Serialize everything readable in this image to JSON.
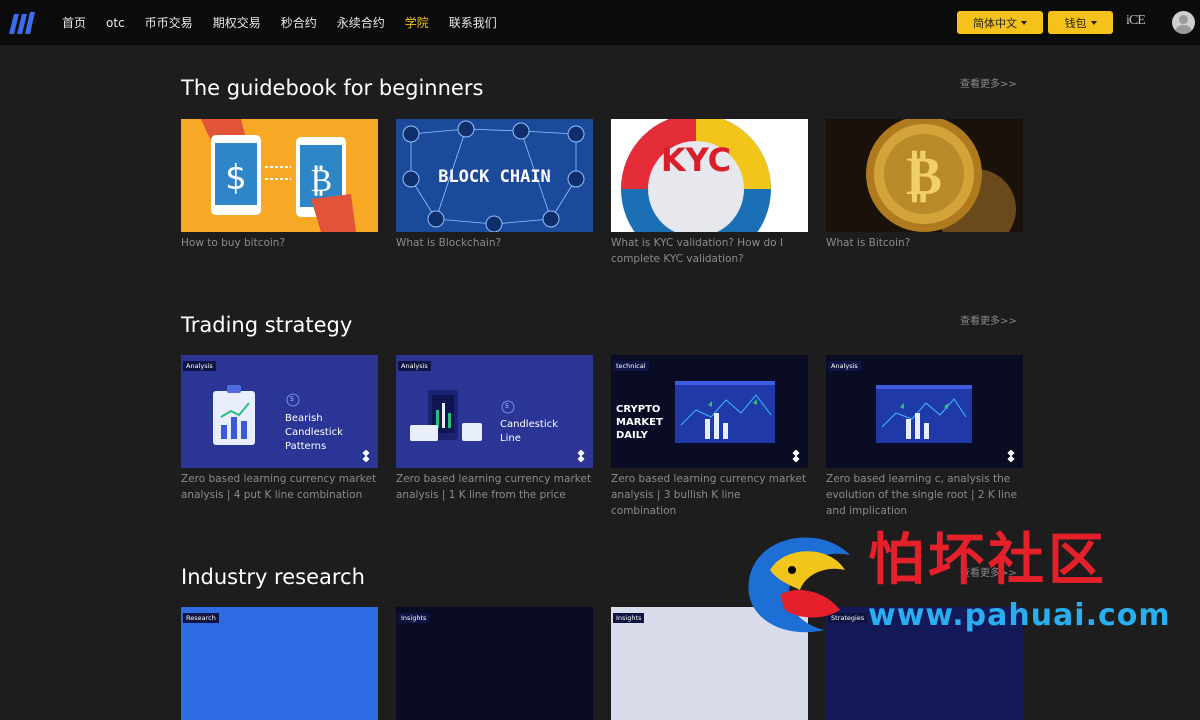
{
  "nav": {
    "items": [
      {
        "label": "首页",
        "active": false
      },
      {
        "label": "otc",
        "active": false
      },
      {
        "label": "币币交易",
        "active": false
      },
      {
        "label": "期权交易",
        "active": false
      },
      {
        "label": "秒合约",
        "active": false
      },
      {
        "label": "永续合约",
        "active": false
      },
      {
        "label": "学院",
        "active": true
      },
      {
        "label": "联系我们",
        "active": false
      }
    ],
    "language_label": "简体中文",
    "wallet_label": "钱包",
    "brand_mark": "iCE"
  },
  "sections": [
    {
      "title": "The guidebook for beginners",
      "more_label": "查看更多>>",
      "cards": [
        {
          "caption": "How to buy bitcoin?",
          "thumb": "buy-bitcoin"
        },
        {
          "caption": "What is Blockchain?",
          "thumb": "block-chain",
          "thumb_text": "BLOCK CHAIN"
        },
        {
          "caption": "What is KYC validation? How do I complete KYC validation?",
          "thumb": "kyc",
          "thumb_text": "KYC"
        },
        {
          "caption": "What is Bitcoin?",
          "thumb": "bitcoin-coin"
        }
      ]
    },
    {
      "title": "Trading strategy",
      "more_label": "查看更多>>",
      "cards": [
        {
          "caption": "Zero based learning currency market analysis | 4 put K line combination",
          "tag": "Analysis",
          "thumb_text": "Bearish Candlestick Patterns",
          "step": "5"
        },
        {
          "caption": "Zero based learning currency market analysis | 1 K line from the price",
          "tag": "Analysis",
          "thumb_text": "Candlestick Line",
          "step": "5"
        },
        {
          "caption": "Zero based learning currency market analysis | 3 bullish K line combination",
          "tag": "technical",
          "thumb_text": "CRYPTO MARKET DAILY"
        },
        {
          "caption": "Zero based learning c, analysis the evolution of the single root | 2 K line and implication",
          "tag": "Analysis"
        }
      ]
    },
    {
      "title": "Industry research",
      "more_label": "查看更多>>",
      "cards": [
        {
          "tag": "Research"
        },
        {
          "tag": "Insights"
        },
        {
          "tag": "Insights"
        },
        {
          "tag": "Strategies"
        }
      ]
    }
  ],
  "watermark": {
    "text": "怕坏社区",
    "url": "www.pahuai.com"
  },
  "colors": {
    "accent": "#f5c21b",
    "background": "#1d1d1d",
    "nav_bg": "#0c0c0c",
    "watermark_red": "#e5202a",
    "watermark_blue": "#29aef0"
  }
}
